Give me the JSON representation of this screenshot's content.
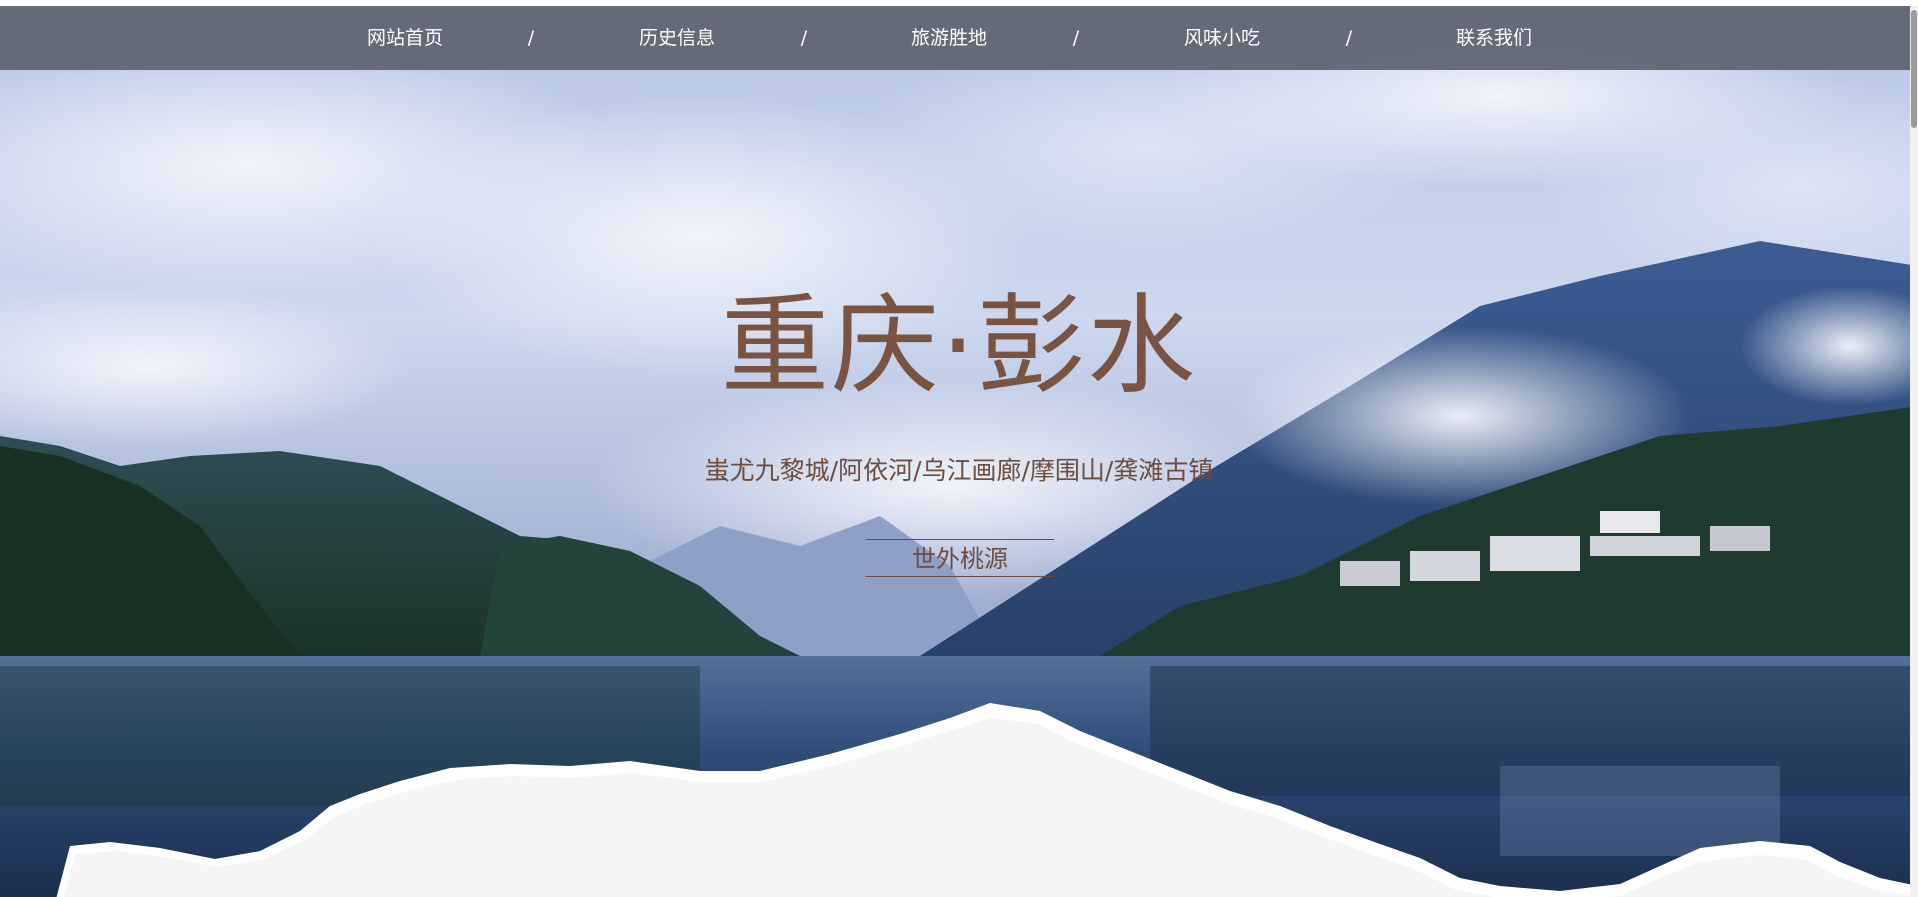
{
  "nav": {
    "items": [
      {
        "label": "网站首页"
      },
      {
        "label": "历史信息"
      },
      {
        "label": "旅游胜地"
      },
      {
        "label": "风味小吃"
      },
      {
        "label": "联系我们"
      }
    ],
    "separator": "/"
  },
  "hero": {
    "title": "重庆·彭水",
    "subtitle": "蚩尤九黎城/阿依河/乌江画廊/摩围山/龚滩古镇",
    "tagline": "世外桃源"
  },
  "colors": {
    "nav_bg": "#5c626e",
    "title_color": "#7a5443",
    "text_brown": "#6e4c3e",
    "paper_white": "#f4f5f7"
  },
  "icons": {
    "background": "mountain-lake-landscape-image",
    "torn_paper": "torn-paper-edge-decoration"
  }
}
